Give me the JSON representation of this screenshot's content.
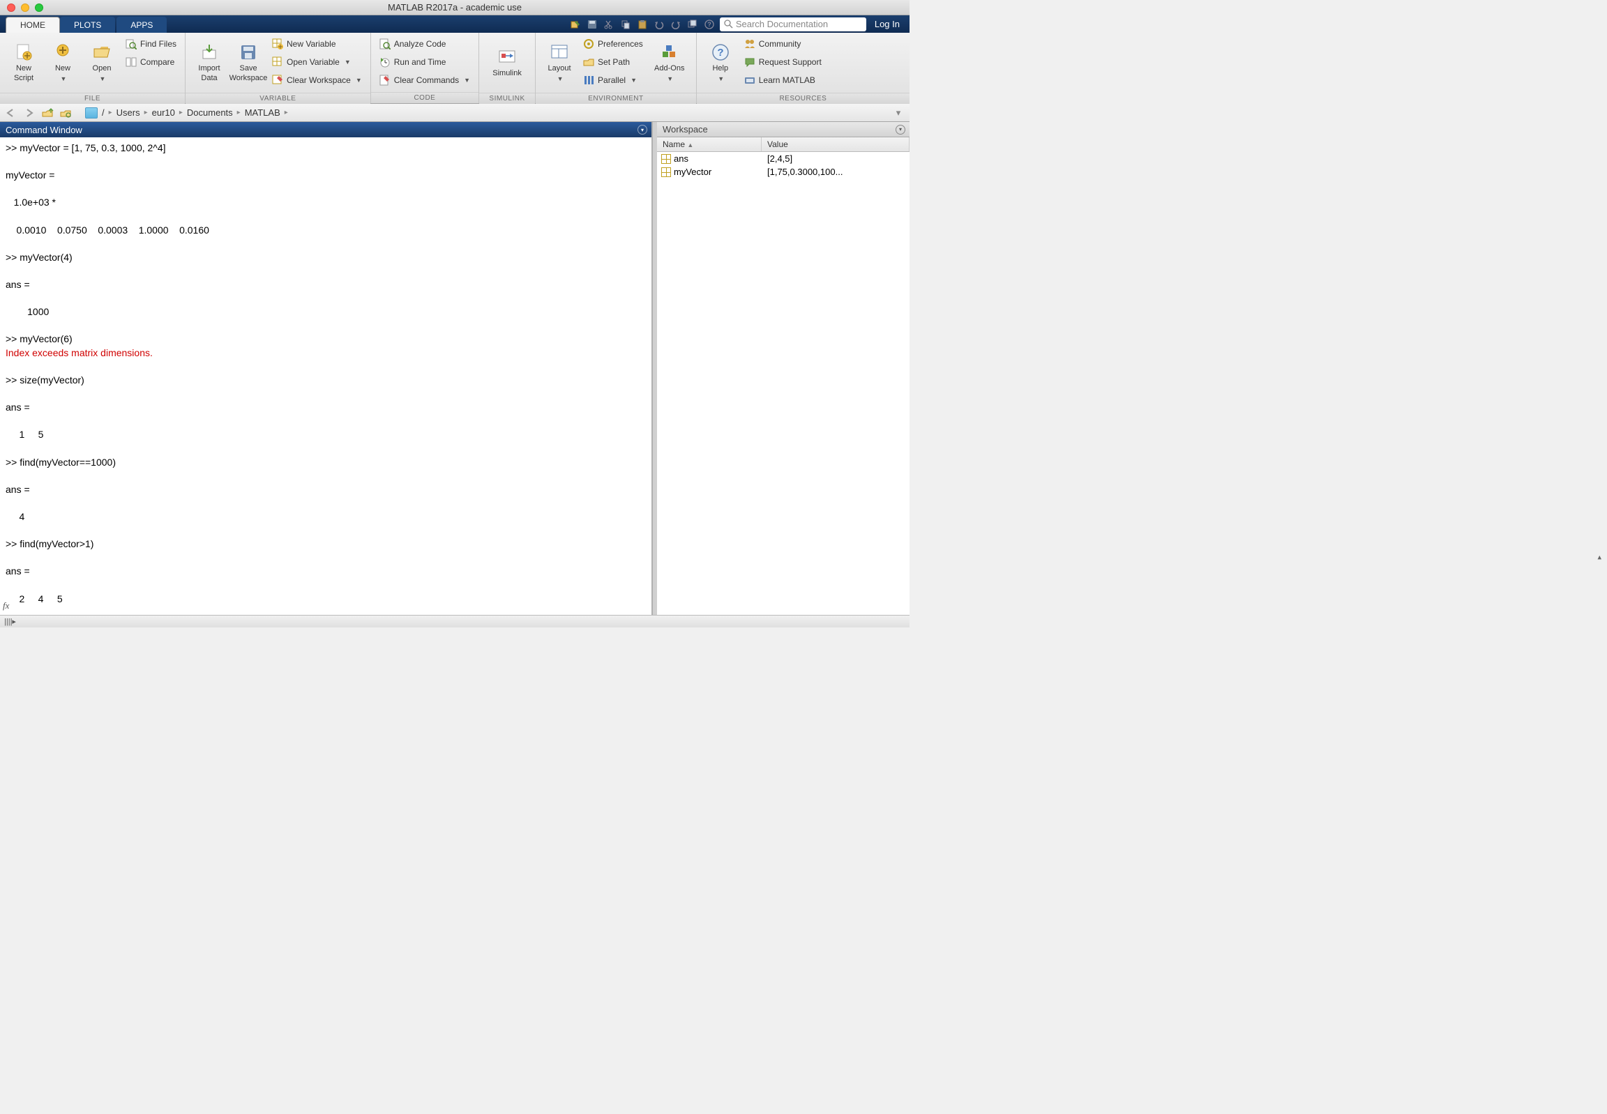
{
  "window": {
    "title": "MATLAB R2017a - academic use"
  },
  "tabs": {
    "home": "HOME",
    "plots": "PLOTS",
    "apps": "APPS"
  },
  "toolbar_right": {
    "search_placeholder": "Search Documentation",
    "login": "Log In"
  },
  "ribbon": {
    "file": {
      "label": "FILE",
      "new_script": "New\nScript",
      "new": "New",
      "open": "Open",
      "find_files": "Find Files",
      "compare": "Compare"
    },
    "variable": {
      "label": "VARIABLE",
      "import_data": "Import\nData",
      "save_workspace": "Save\nWorkspace",
      "new_variable": "New Variable",
      "open_variable": "Open Variable",
      "clear_workspace": "Clear Workspace"
    },
    "code": {
      "label": "CODE",
      "analyze_code": "Analyze Code",
      "run_and_time": "Run and Time",
      "clear_commands": "Clear Commands"
    },
    "simulink": {
      "label": "SIMULINK",
      "simulink": "Simulink"
    },
    "environment": {
      "label": "ENVIRONMENT",
      "layout": "Layout",
      "preferences": "Preferences",
      "set_path": "Set Path",
      "parallel": "Parallel",
      "addons": "Add-Ons"
    },
    "resources": {
      "label": "RESOURCES",
      "help": "Help",
      "community": "Community",
      "request_support": "Request Support",
      "learn_matlab": "Learn MATLAB"
    }
  },
  "path": {
    "segments": [
      "/",
      "Users",
      "eur10",
      "Documents",
      "MATLAB"
    ]
  },
  "command_window": {
    "title": "Command Window",
    "lines": [
      {
        "t": ">> myVector = [1, 75, 0.3, 1000, 2^4]",
        "err": false
      },
      {
        "t": "",
        "err": false
      },
      {
        "t": "myVector =",
        "err": false
      },
      {
        "t": "",
        "err": false
      },
      {
        "t": "   1.0e+03 *",
        "err": false
      },
      {
        "t": "",
        "err": false
      },
      {
        "t": "    0.0010    0.0750    0.0003    1.0000    0.0160",
        "err": false
      },
      {
        "t": "",
        "err": false
      },
      {
        "t": ">> myVector(4)",
        "err": false
      },
      {
        "t": "",
        "err": false
      },
      {
        "t": "ans =",
        "err": false
      },
      {
        "t": "",
        "err": false
      },
      {
        "t": "        1000",
        "err": false
      },
      {
        "t": "",
        "err": false
      },
      {
        "t": ">> myVector(6)",
        "err": false
      },
      {
        "t": "Index exceeds matrix dimensions.",
        "err": true
      },
      {
        "t": "",
        "err": false
      },
      {
        "t": ">> size(myVector)",
        "err": false
      },
      {
        "t": "",
        "err": false
      },
      {
        "t": "ans =",
        "err": false
      },
      {
        "t": "",
        "err": false
      },
      {
        "t": "     1     5",
        "err": false
      },
      {
        "t": "",
        "err": false
      },
      {
        "t": ">> find(myVector==1000)",
        "err": false
      },
      {
        "t": "",
        "err": false
      },
      {
        "t": "ans =",
        "err": false
      },
      {
        "t": "",
        "err": false
      },
      {
        "t": "     4",
        "err": false
      },
      {
        "t": "",
        "err": false
      },
      {
        "t": ">> find(myVector>1)",
        "err": false
      },
      {
        "t": "",
        "err": false
      },
      {
        "t": "ans =",
        "err": false
      },
      {
        "t": "",
        "err": false
      },
      {
        "t": "     2     4     5",
        "err": false
      }
    ]
  },
  "workspace": {
    "title": "Workspace",
    "cols": {
      "name": "Name",
      "value": "Value"
    },
    "vars": [
      {
        "name": "ans",
        "value": "[2,4,5]"
      },
      {
        "name": "myVector",
        "value": "[1,75,0.3000,100..."
      }
    ]
  }
}
